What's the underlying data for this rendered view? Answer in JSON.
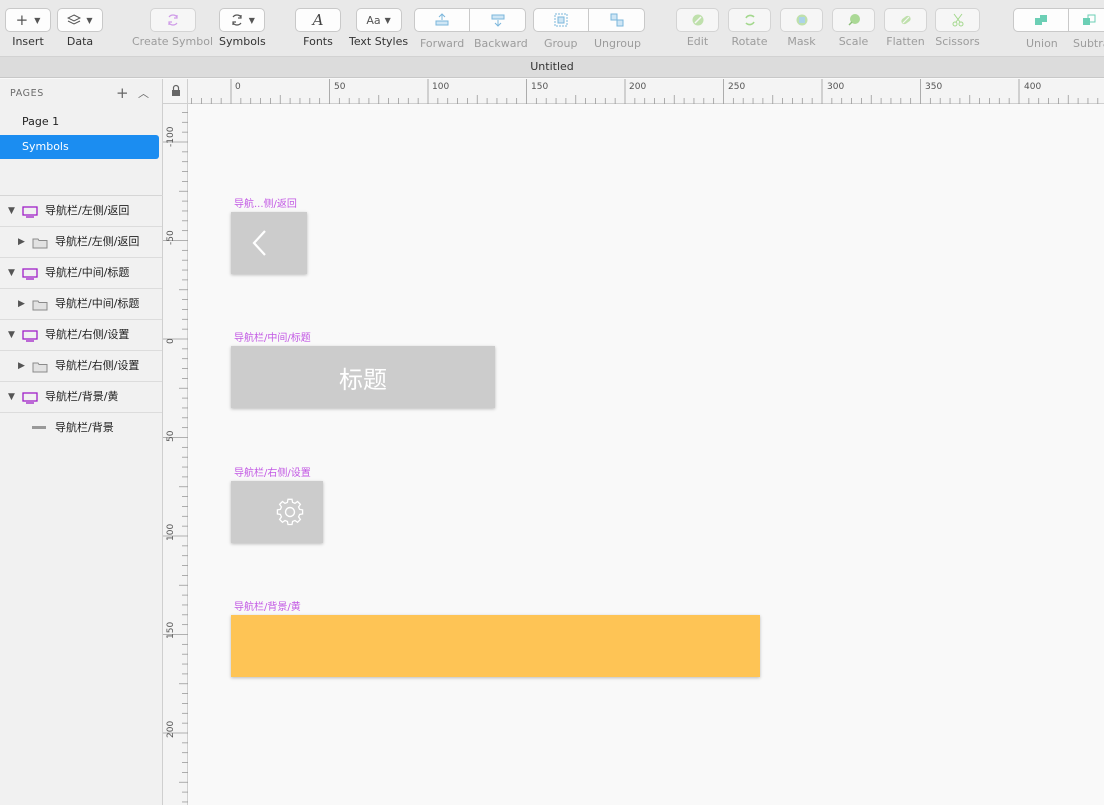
{
  "toolbar": {
    "insert": "Insert",
    "data": "Data",
    "create_symbol": "Create Symbol",
    "symbols": "Symbols",
    "fonts": "Fonts",
    "text_styles": "Text Styles",
    "text_styles_icon": "Aa",
    "forward": "Forward",
    "backward": "Backward",
    "group": "Group",
    "ungroup": "Ungroup",
    "edit": "Edit",
    "rotate": "Rotate",
    "mask": "Mask",
    "scale": "Scale",
    "flatten": "Flatten",
    "scissors": "Scissors",
    "union": "Union",
    "subtract": "Subtra"
  },
  "window": {
    "title": "Untitled"
  },
  "pages": {
    "header": "PAGES",
    "items": [
      {
        "label": "Page 1",
        "selected": false
      },
      {
        "label": "Symbols",
        "selected": true
      }
    ]
  },
  "layers": [
    {
      "label": "导航栏/左侧/返回",
      "type": "artboard",
      "expanded": true
    },
    {
      "label": "导航栏/左侧/返回",
      "type": "group",
      "expanded": false
    },
    {
      "label": "导航栏/中间/标题",
      "type": "artboard",
      "expanded": true
    },
    {
      "label": "导航栏/中间/标题",
      "type": "group",
      "expanded": false
    },
    {
      "label": "导航栏/右侧/设置",
      "type": "artboard",
      "expanded": true
    },
    {
      "label": "导航栏/右侧/设置",
      "type": "group",
      "expanded": false
    },
    {
      "label": "导航栏/背景/黄",
      "type": "artboard",
      "expanded": true
    },
    {
      "label": "导航栏/背景",
      "type": "rectangle"
    }
  ],
  "ruler": {
    "horizontal": [
      "0",
      "50",
      "100",
      "150",
      "200",
      "250",
      "300",
      "350",
      "400"
    ],
    "vertical": [
      "-100",
      "-50",
      "0",
      "50",
      "100",
      "150",
      "200"
    ]
  },
  "canvas": {
    "artboards": [
      {
        "label": "导航...侧/返回",
        "content_icon": "chevron-left",
        "fill": "#cccccc"
      },
      {
        "label": "导航栏/中间/标题",
        "content_text": "标题",
        "fill": "#cccccc"
      },
      {
        "label": "导航栏/右侧/设置",
        "content_icon": "gear",
        "fill": "#cccccc"
      },
      {
        "label": "导航栏/背景/黄",
        "fill": "#fec455"
      }
    ]
  },
  "colors": {
    "accent": "#1b8df1",
    "artboard_label": "#c258e4",
    "symbol_icon": "#a020c8"
  }
}
